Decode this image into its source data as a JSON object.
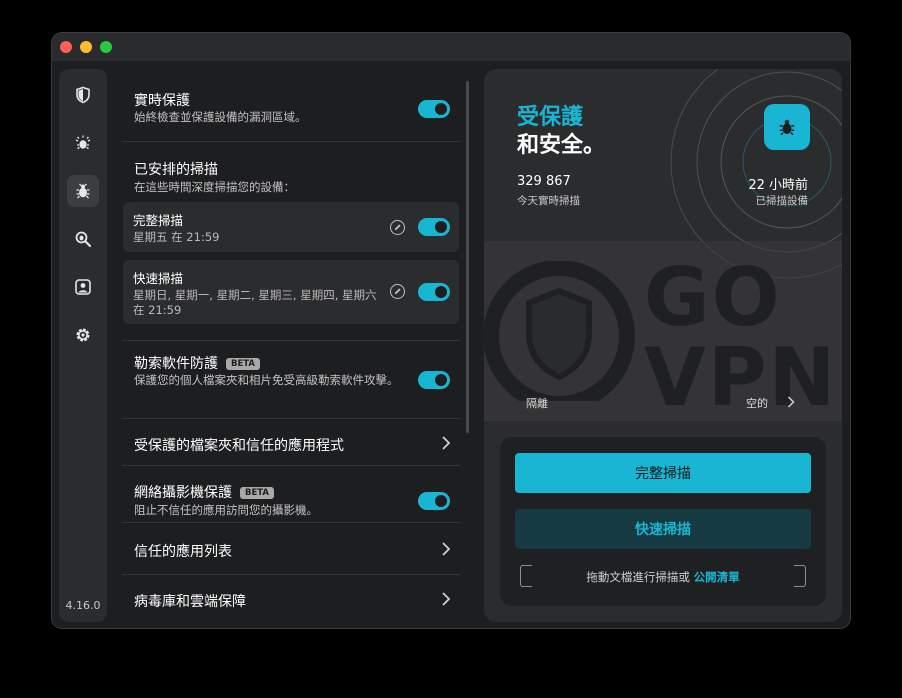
{
  "sidebar": {
    "version": "4.16.0",
    "items": [
      {
        "name": "shield-icon"
      },
      {
        "name": "alarm-bug-icon"
      },
      {
        "name": "bug-icon",
        "active": true
      },
      {
        "name": "search-bug-icon"
      },
      {
        "name": "account-icon"
      },
      {
        "name": "gear-icon"
      }
    ]
  },
  "settings": {
    "realtime": {
      "title": "實時保護",
      "desc": "始終檢查並保護設備的漏洞區域。",
      "enabled": true
    },
    "scheduled": {
      "title": "已安排的掃描",
      "desc": "在這些時間深度掃描您的設備：",
      "full": {
        "title": "完整掃描",
        "schedule": "星期五 在 21:59",
        "enabled": true
      },
      "quick": {
        "title": "快速掃描",
        "schedule": "星期日, 星期一, 星期二, 星期三, 星期四, 星期六 在 21:59",
        "enabled": true
      }
    },
    "ransomware": {
      "title": "勒索軟件防護",
      "badge": "BETA",
      "desc": "保護您的個人檔案夾和相片免受高級勒索軟件攻擊。",
      "enabled": true
    },
    "protected_folders": {
      "title": "受保護的檔案夾和信任的應用程式"
    },
    "webcam": {
      "title": "網絡攝影機保護",
      "badge": "BETA",
      "desc": "阻止不信任的應用訪問您的攝影機。",
      "enabled": true
    },
    "trusted_apps": {
      "title": "信任的應用列表"
    },
    "virus_db": {
      "title": "病毒庫和雲端保障"
    }
  },
  "status": {
    "line1": "受保護",
    "line2": "和安全。",
    "stat1_value": "329 867",
    "stat1_label": "今天實時掃描",
    "stat2_value": "22 小時前",
    "stat2_label": "已掃描設備",
    "quarantine_label": "隔離",
    "quarantine_value": "空的",
    "watermark_line1": "GO",
    "watermark_line2": "VPN"
  },
  "scan": {
    "full_button": "完整掃描",
    "quick_button": "快速掃描",
    "drop_text": "拖動文檔進行掃描或 ",
    "drop_link": "公開清單"
  },
  "colors": {
    "accent": "#19b6d3",
    "background": "#1d1e20",
    "panel": "#2b2c2e"
  }
}
